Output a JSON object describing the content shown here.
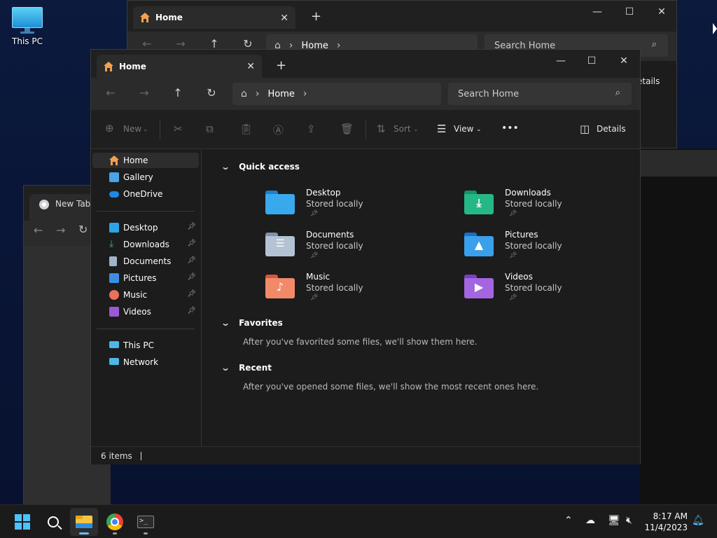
{
  "desktop": {
    "icons": [
      {
        "label": "This PC",
        "icon": "monitor-icon"
      }
    ]
  },
  "back_window": {
    "tab_title": "Home",
    "address_crumb": "Home",
    "search_placeholder": "Search Home",
    "details_label": "etails"
  },
  "browser_window": {
    "tab_title": "New Tab"
  },
  "explorer": {
    "tab_title": "Home",
    "address": {
      "crumb": "Home"
    },
    "search_placeholder": "Search Home",
    "toolbar": {
      "new_label": "New",
      "sort_label": "Sort",
      "view_label": "View",
      "more_label": "•••",
      "details_label": "Details"
    },
    "nav_pane": {
      "top_items": [
        {
          "label": "Home",
          "icon": "home-icon",
          "color": "#f0a050",
          "selected": true
        },
        {
          "label": "Gallery",
          "icon": "gallery-icon",
          "color": "#4aa3e8"
        },
        {
          "label": "OneDrive",
          "icon": "onedrive-icon",
          "color": "#1e88e5"
        }
      ],
      "pinned_items": [
        {
          "label": "Desktop",
          "icon": "desktop-icon",
          "color": "#2ea3e6"
        },
        {
          "label": "Downloads",
          "icon": "downloads-icon",
          "color": "#2db37a"
        },
        {
          "label": "Documents",
          "icon": "documents-icon",
          "color": "#9fb4c8"
        },
        {
          "label": "Pictures",
          "icon": "pictures-icon",
          "color": "#3d8ee0"
        },
        {
          "label": "Music",
          "icon": "music-icon",
          "color": "#e8715a"
        },
        {
          "label": "Videos",
          "icon": "videos-icon",
          "color": "#9b59d6"
        }
      ],
      "device_items": [
        {
          "label": "This PC",
          "icon": "this-pc-icon",
          "color": "#4cb8e8"
        },
        {
          "label": "Network",
          "icon": "network-icon",
          "color": "#4cb8e8"
        }
      ]
    },
    "quick_access": {
      "header": "Quick access",
      "items": [
        {
          "name": "Desktop",
          "status": "Stored locally",
          "icon": "desktop-folder-icon",
          "color_back": "#1a7fd0",
          "color_front": "#39a9ee"
        },
        {
          "name": "Downloads",
          "status": "Stored locally",
          "icon": "downloads-folder-icon",
          "color_back": "#14906a",
          "color_front": "#25b886"
        },
        {
          "name": "Documents",
          "status": "Stored locally",
          "icon": "documents-folder-icon",
          "color_back": "#7f93a8",
          "color_front": "#b3c3d3"
        },
        {
          "name": "Pictures",
          "status": "Stored locally",
          "icon": "pictures-folder-icon",
          "color_back": "#1b6fc8",
          "color_front": "#3aa0ec"
        },
        {
          "name": "Music",
          "status": "Stored locally",
          "icon": "music-folder-icon",
          "color_back": "#d4583f",
          "color_front": "#f28a6a"
        },
        {
          "name": "Videos",
          "status": "Stored locally",
          "icon": "videos-folder-icon",
          "color_back": "#7a3fc0",
          "color_front": "#a366e0"
        }
      ]
    },
    "favorites": {
      "header": "Favorites",
      "message": "After you've favorited some files, we'll show them here."
    },
    "recent": {
      "header": "Recent",
      "message": "After you've opened some files, we'll show the most recent ones here."
    },
    "status": {
      "item_count": "6 items"
    }
  },
  "taskbar": {
    "apps": [
      "start-icon",
      "search-icon",
      "file-explorer-icon",
      "chrome-icon",
      "terminal-icon"
    ],
    "clock_time": "8:17 AM",
    "clock_date": "11/4/2023"
  }
}
